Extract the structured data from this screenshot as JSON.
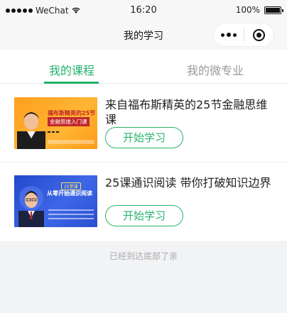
{
  "status_bar": {
    "carrier": "WeChat",
    "time": "16:20",
    "battery": "100%",
    "battery_level": 1.0
  },
  "nav": {
    "title": "我的学习"
  },
  "tabs": [
    {
      "label": "我的课程",
      "active": true
    },
    {
      "label": "我的微专业",
      "active": false
    }
  ],
  "courses": [
    {
      "title": "来自福布斯精英的25节金融思维课",
      "button": "开始学习",
      "thumb": {
        "line1": "福布斯精英的25节",
        "line2": "金融思维入门课"
      }
    },
    {
      "title": "25课通识阅读 带你打破知识边界",
      "button": "开始学习",
      "thumb": {
        "badge": "25堂课",
        "line1": "从零开始通识阅读"
      }
    }
  ],
  "footer": {
    "note": "已经到达底部了亲"
  },
  "colors": {
    "accent": "#23b26b",
    "background": "#f2f3f5"
  },
  "icons": {
    "more": "more-dots-icon",
    "close": "close-ring-icon",
    "signal": "signal-dots-icon",
    "wifi": "wifi-icon",
    "battery": "battery-icon"
  }
}
